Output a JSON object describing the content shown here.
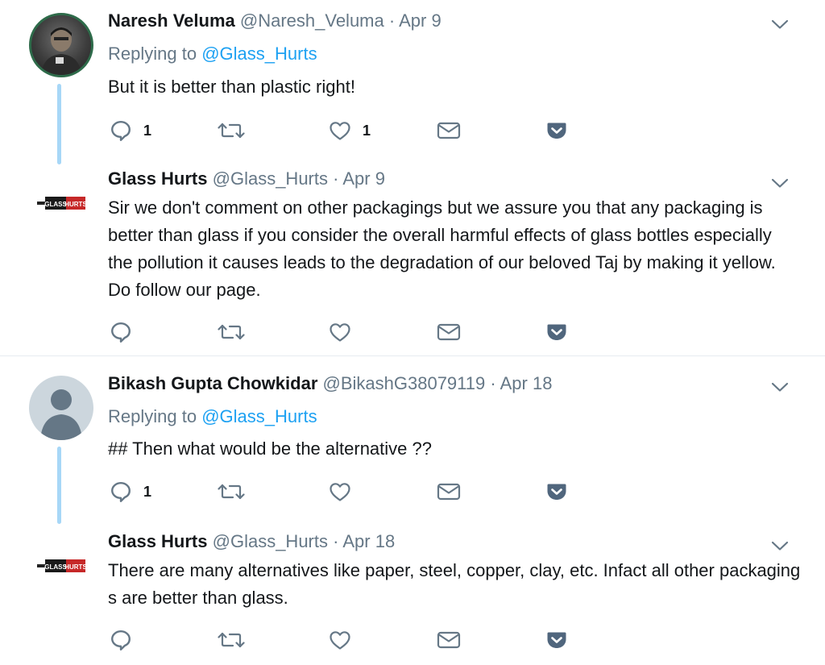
{
  "tweets": [
    {
      "name": "Naresh Veluma",
      "handle": "@Naresh_Veluma",
      "separator": "·",
      "date": "Apr 9",
      "replying_prefix": "Replying to",
      "replying_to": "@Glass_Hurts",
      "text": "But it is better than plastic right!",
      "reply_count": "1",
      "retweet_count": "",
      "like_count": "1",
      "avatar": "user-photo"
    },
    {
      "name": "Glass Hurts",
      "handle": "@Glass_Hurts",
      "separator": "·",
      "date": "Apr 9",
      "text": "Sir we don't comment on other packagings but we assure you that any packaging is better than glass if you consider the overall harmful effects of glass bottles especially the pollution it causes leads to the degradation of our beloved Taj by making it yellow. Do follow our page.",
      "reply_count": "",
      "retweet_count": "",
      "like_count": "",
      "avatar": "glass-hurts-logo",
      "logo_text": "GLASS HURTS"
    },
    {
      "name": "Bikash Gupta Chowkidar",
      "handle": "@BikashG38079119",
      "separator": "·",
      "date": "Apr 18",
      "replying_prefix": "Replying to",
      "replying_to": "@Glass_Hurts",
      "text": "## Then what would be the alternative ??",
      "reply_count": "1",
      "retweet_count": "",
      "like_count": "",
      "avatar": "default-avatar"
    },
    {
      "name": "Glass Hurts",
      "handle": "@Glass_Hurts",
      "separator": "·",
      "date": "Apr 18",
      "text": "There are many alternatives like paper, steel, copper, clay, etc. Infact all other packaging s are better than glass.",
      "reply_count": "",
      "retweet_count": "",
      "like_count": "",
      "avatar": "glass-hurts-logo",
      "logo_text": "GLASS HURTS"
    }
  ],
  "colors": {
    "text": "#14171a",
    "muted": "#657786",
    "link": "#1da1f2",
    "thread_line": "#a7d7f7",
    "pocket": "#50667d",
    "divider": "#e6ecf0"
  },
  "icons": [
    "reply-icon",
    "retweet-icon",
    "like-icon",
    "dm-icon",
    "pocket-icon",
    "caret-down-icon"
  ]
}
